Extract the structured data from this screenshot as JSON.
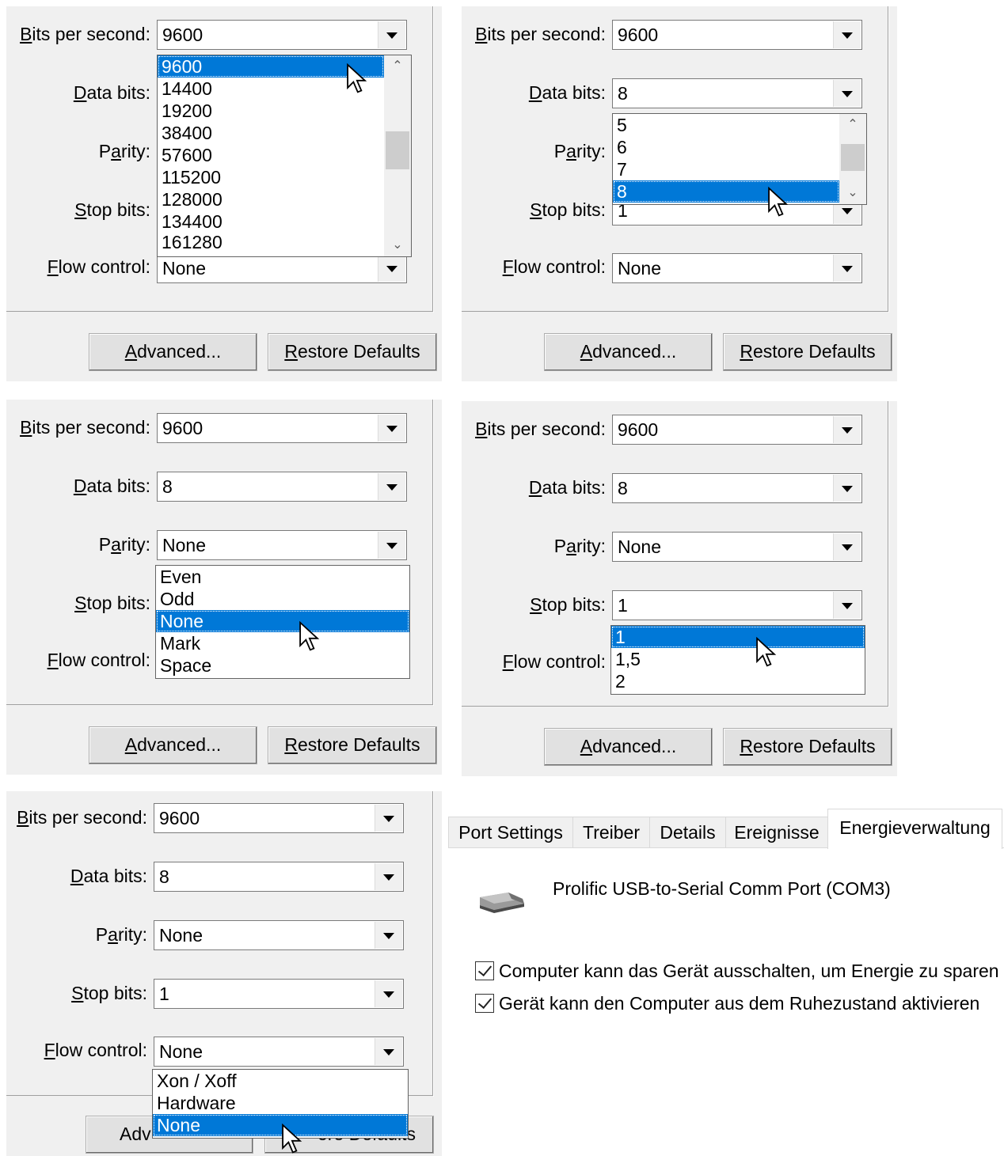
{
  "labels": {
    "bits_per_second": {
      "acc": "B",
      "rest": "its per second:"
    },
    "data_bits": {
      "acc": "D",
      "rest": "ata bits:"
    },
    "parity": {
      "pre": "P",
      "acc": "a",
      "rest": "rity:"
    },
    "stop_bits": {
      "acc": "S",
      "rest": "top bits:"
    },
    "flow_control": {
      "acc": "F",
      "rest": "low control:"
    }
  },
  "buttons": {
    "advanced": {
      "acc": "A",
      "rest": "dvanced..."
    },
    "restore_defaults": {
      "acc": "R",
      "rest": "estore Defaults"
    }
  },
  "panels": [
    {
      "bits_per_second": "9600",
      "flow_control": "None",
      "open_dropdown": "bits_per_second",
      "options": [
        "9600",
        "14400",
        "19200",
        "38400",
        "57600",
        "115200",
        "128000",
        "134400",
        "161280"
      ],
      "selected": "9600"
    },
    {
      "bits_per_second": "9600",
      "data_bits": "8",
      "stop_bits": "1",
      "flow_control": "None",
      "open_dropdown": "data_bits",
      "options": [
        "5",
        "6",
        "7",
        "8"
      ],
      "selected": "8"
    },
    {
      "bits_per_second": "9600",
      "data_bits": "8",
      "parity": "None",
      "open_dropdown": "parity",
      "options": [
        "Even",
        "Odd",
        "None",
        "Mark",
        "Space"
      ],
      "selected": "None"
    },
    {
      "bits_per_second": "9600",
      "data_bits": "8",
      "parity": "None",
      "stop_bits": "1",
      "open_dropdown": "stop_bits",
      "options": [
        "1",
        "1,5",
        "2"
      ],
      "selected": "1"
    },
    {
      "bits_per_second": "9600",
      "data_bits": "8",
      "parity": "None",
      "stop_bits": "1",
      "flow_control": "None",
      "open_dropdown": "flow_control",
      "options": [
        "Xon / Xoff",
        "Hardware",
        "None"
      ],
      "selected": "None",
      "obscured_buttons": {
        "advanced_visible": "Adv",
        "restore_visible": "ore Defaults"
      }
    }
  ],
  "properties": {
    "tabs": [
      {
        "label": "Port Settings"
      },
      {
        "label": "Treiber"
      },
      {
        "label": "Details"
      },
      {
        "label": "Ereignisse"
      },
      {
        "label": "Energieverwaltung",
        "active": true
      }
    ],
    "device_name": "Prolific USB-to-Serial Comm Port (COM3)",
    "device_icon": "serial-port-icon",
    "checkboxes": [
      {
        "label": "Computer kann das Gerät ausschalten, um Energie zu sparen",
        "checked": true
      },
      {
        "label": "Gerät kann den Computer aus dem Ruhezustand aktivieren",
        "checked": true
      }
    ]
  },
  "colors": {
    "selection": "#0078d7",
    "dialog_bg": "#f0f0f0"
  }
}
